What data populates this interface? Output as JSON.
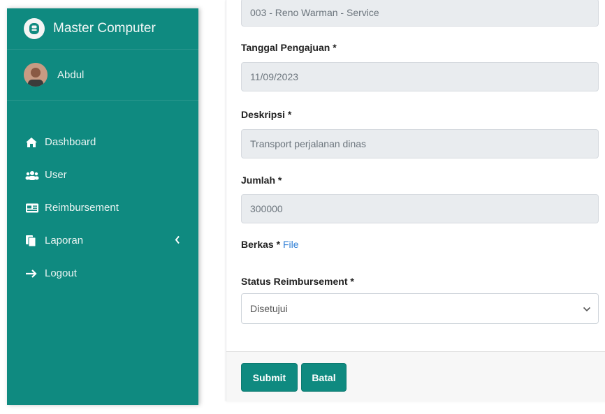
{
  "sidebar": {
    "brand": "Master Computer",
    "user": "Abdul",
    "items": [
      {
        "label": "Dashboard",
        "icon": "home-icon"
      },
      {
        "label": "User",
        "icon": "users-icon"
      },
      {
        "label": "Reimbursement",
        "icon": "card-icon"
      },
      {
        "label": "Laporan",
        "icon": "copy-icon"
      },
      {
        "label": "Logout",
        "icon": "arrow-right-icon"
      }
    ]
  },
  "form": {
    "top_value": "003 - Reno Warman - Service",
    "tanggal_label": "Tanggal Pengajuan *",
    "tanggal_value": "11/09/2023",
    "deskripsi_label": "Deskripsi *",
    "deskripsi_value": "Transport perjalanan dinas",
    "jumlah_label": "Jumlah *",
    "jumlah_value": "300000",
    "berkas_label": "Berkas *",
    "berkas_link": "File",
    "status_label": "Status Reimbursement *",
    "status_selected": "Disetujui"
  },
  "buttons": {
    "submit": "Submit",
    "batal": "Batal"
  },
  "colors": {
    "primary": "#0f8a80"
  }
}
